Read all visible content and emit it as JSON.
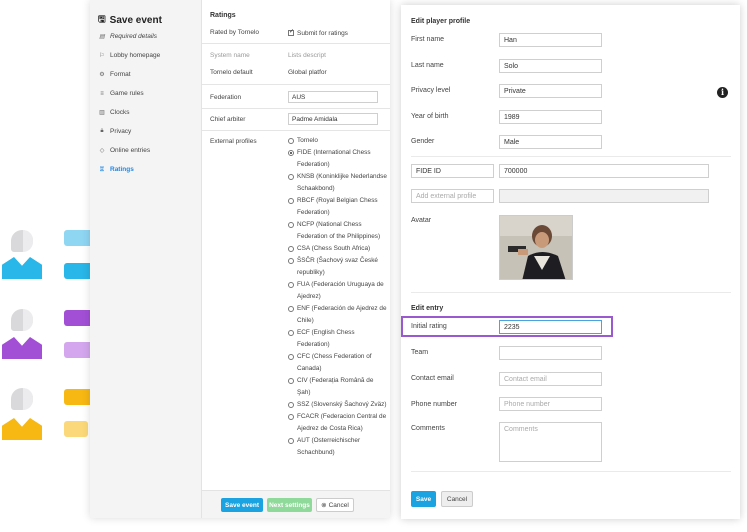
{
  "colors": {
    "blue": "#1aa3e0",
    "green": "#8fd99a",
    "purple": "#9b59d0",
    "deco_blue": "#29b6e8",
    "deco_purple": "#a24fd6",
    "deco_yellow": "#f7b813"
  },
  "sidebar": {
    "title": "Save event",
    "title_icon": "save-icon",
    "items": [
      {
        "label": "Required details",
        "icon": "required-icon"
      },
      {
        "label": "Lobby homepage",
        "icon": "lobby-icon"
      },
      {
        "label": "Format",
        "icon": "format-icon"
      },
      {
        "label": "Game rules",
        "icon": "game-rules-icon"
      },
      {
        "label": "Clocks",
        "icon": "clock-icon"
      },
      {
        "label": "Privacy",
        "icon": "lock-icon"
      },
      {
        "label": "Online entries",
        "icon": "online-icon"
      },
      {
        "label": "Ratings",
        "icon": "trophy-icon"
      }
    ]
  },
  "ratings": {
    "heading": "Ratings",
    "rated_by_label": "Rated by Tornelo",
    "submit_label": "Submit for ratings",
    "system_name_label": "System name",
    "system_name_value": "Tornelo default",
    "list_descr_label": "Lists descript",
    "list_descr_value": "Global platfor",
    "federation_label": "Federation",
    "federation_value": "AUS",
    "chief_arbiter_label": "Chief arbiter",
    "chief_arbiter_value": "Padme Amidala",
    "external_label": "External profiles",
    "profiles": [
      "Tornelo",
      "FIDE (International Chess Federation)",
      "KNSB (Koninklijke Nederlandse Schaakbond)",
      "RBCF (Royal Belgian Chess Federation)",
      "NCFP (National Chess Federation of the Philippines)",
      "CSA (Chess South Africa)",
      "ŠSČR (Šachový svaz České republiky)",
      "FUA (Federación Uruguaya de Ajedrez)",
      "ENF (Federación de Ajedrez de Chile)",
      "ECF (English Chess Federation)",
      "CFC (Chess Federation of Canada)",
      "CIV (Federația Română de Şah)",
      "SSZ (Slovenský Šachový Zväz)",
      "FCACR (Federacion Central de Ajedrez de Costa Rica)",
      "AUT (Osterreichischer Schachbund)"
    ],
    "selected_profile_index": 1
  },
  "footer": {
    "save_event": "Save event",
    "next_settings": "Next settings",
    "cancel": "Cancel"
  },
  "profile": {
    "heading": "Edit player profile",
    "first_name_label": "First name",
    "first_name_value": "Han",
    "last_name_label": "Last name",
    "last_name_value": "Solo",
    "privacy_label": "Privacy level",
    "privacy_value": "Private",
    "year_label": "Year of birth",
    "year_value": "1989",
    "gender_label": "Gender",
    "gender_value": "Male",
    "fide_label": "FIDE ID",
    "fide_value": "700000",
    "add_external_placeholder": "Add external profile",
    "avatar_label": "Avatar",
    "entry_heading": "Edit entry",
    "initial_rating_label": "Initial rating",
    "initial_rating_value": "2235",
    "team_label": "Team",
    "contact_email_label": "Contact email",
    "contact_email_placeholder": "Contact email",
    "phone_label": "Phone number",
    "phone_placeholder": "Phone number",
    "comments_label": "Comments",
    "comments_placeholder": "Comments",
    "save": "Save",
    "cancel": "Cancel"
  }
}
